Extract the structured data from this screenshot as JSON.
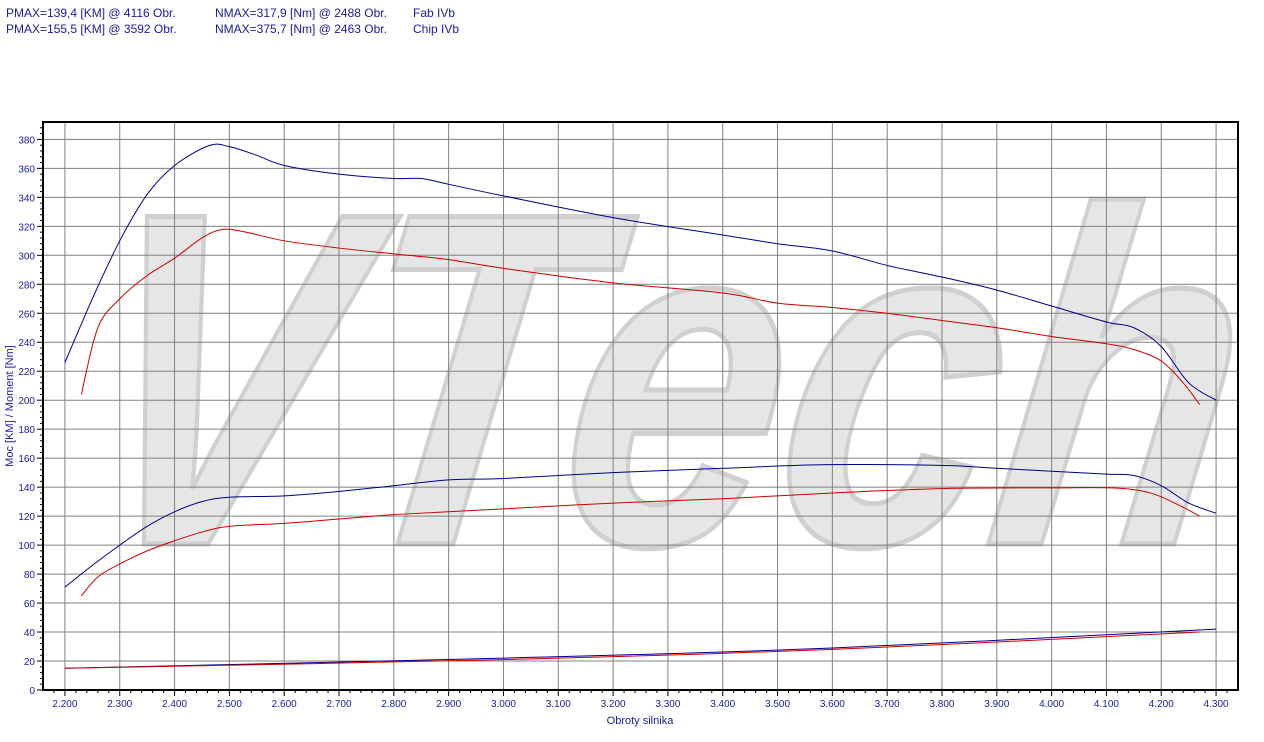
{
  "header": {
    "rows": [
      {
        "pmax": "PMAX=139,4 [KM] @ 4116 Obr.",
        "nmax": "NMAX=317,9 [Nm] @ 2488 Obr.",
        "name": "Fab IVb"
      },
      {
        "pmax": "PMAX=155,5 [KM] @ 3592 Obr.",
        "nmax": "NMAX=375,7 [Nm] @ 2463 Obr.",
        "name": "Chip IVb"
      }
    ]
  },
  "watermark": "VTech",
  "chart_data": {
    "type": "line",
    "xlabel": "Obroty silnika",
    "ylabel": "Moc [KM] / Moment [Nm]",
    "xlim": [
      2160,
      4340
    ],
    "ylim": [
      0,
      392
    ],
    "xticks": [
      2200,
      2300,
      2400,
      2500,
      2600,
      2700,
      2800,
      2900,
      3000,
      3100,
      3200,
      3300,
      3400,
      3500,
      3600,
      3700,
      3800,
      3900,
      4000,
      4100,
      4200,
      4300
    ],
    "xtick_labels": [
      "2.200",
      "2.300",
      "2.400",
      "2.500",
      "2.600",
      "2.700",
      "2.800",
      "2.900",
      "3.000",
      "3.100",
      "3.200",
      "3.300",
      "3.400",
      "3.500",
      "3.600",
      "3.700",
      "3.800",
      "3.900",
      "4.000",
      "4.100",
      "4.200",
      "4.300"
    ],
    "yticks": [
      0,
      20,
      40,
      60,
      80,
      100,
      120,
      140,
      160,
      180,
      200,
      220,
      240,
      260,
      280,
      300,
      320,
      340,
      360,
      380
    ],
    "grid": true,
    "series": [
      {
        "name": "Chip IVb torque",
        "color": "#00008b",
        "x": [
          2200,
          2250,
          2300,
          2350,
          2400,
          2463,
          2500,
          2550,
          2600,
          2700,
          2800,
          2850,
          2900,
          3000,
          3200,
          3400,
          3500,
          3600,
          3700,
          3800,
          3900,
          4000,
          4100,
          4150,
          4200,
          4250,
          4300
        ],
        "y": [
          226,
          270,
          310,
          342,
          362,
          375.7,
          375,
          369,
          362,
          356,
          353,
          353,
          349,
          341,
          326,
          314,
          308,
          303,
          293,
          285,
          276,
          265,
          254,
          250,
          237,
          212,
          200
        ]
      },
      {
        "name": "Fab IVb torque",
        "color": "#cc0000",
        "x": [
          2230,
          2260,
          2300,
          2350,
          2400,
          2450,
          2488,
          2530,
          2600,
          2700,
          2800,
          2900,
          3000,
          3200,
          3400,
          3500,
          3600,
          3700,
          3800,
          3900,
          4000,
          4100,
          4150,
          4200,
          4240,
          4270
        ],
        "y": [
          204,
          250,
          270,
          286,
          298,
          312,
          317.9,
          316,
          310,
          305,
          301,
          297,
          291,
          281,
          274,
          267,
          264,
          260,
          255,
          250,
          244,
          239,
          235,
          227,
          212,
          197
        ]
      },
      {
        "name": "Chip IVb power",
        "color": "#00008b",
        "x": [
          2200,
          2250,
          2300,
          2350,
          2400,
          2450,
          2500,
          2600,
          2700,
          2800,
          2900,
          3000,
          3200,
          3400,
          3592,
          3800,
          3900,
          4000,
          4100,
          4150,
          4200,
          4250,
          4300
        ],
        "y": [
          71,
          86,
          100,
          113,
          123,
          130,
          133,
          134,
          137,
          141,
          145,
          146,
          150,
          153,
          155.5,
          155,
          153,
          151,
          149,
          148,
          141,
          129,
          122
        ]
      },
      {
        "name": "Fab IVb power",
        "color": "#cc0000",
        "x": [
          2230,
          2260,
          2300,
          2350,
          2400,
          2450,
          2500,
          2600,
          2700,
          2800,
          2900,
          3000,
          3200,
          3400,
          3600,
          3800,
          4000,
          4116,
          4180,
          4230,
          4270
        ],
        "y": [
          65,
          78,
          87,
          96,
          103,
          109,
          113,
          115,
          118,
          121,
          123,
          125,
          129,
          132,
          136,
          139,
          139.5,
          139.4,
          136,
          128,
          120
        ]
      },
      {
        "name": "Chip IVb losses",
        "color": "#00008b",
        "x": [
          2200,
          3000,
          3600,
          4300
        ],
        "y": [
          15,
          22,
          29,
          42
        ]
      },
      {
        "name": "Fab IVb losses",
        "color": "#cc0000",
        "x": [
          2200,
          3000,
          3600,
          4270
        ],
        "y": [
          15,
          21,
          28,
          40
        ]
      }
    ]
  }
}
